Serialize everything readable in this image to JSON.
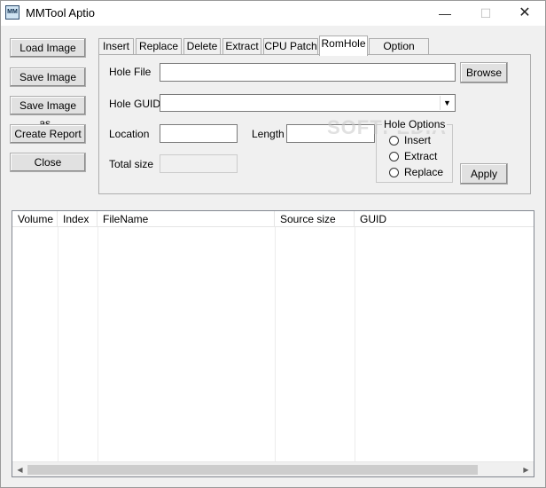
{
  "window": {
    "title": "MMTool Aptio",
    "icon": "MM"
  },
  "controls": {
    "minimize": "—",
    "maximize": "☐",
    "close": "✕"
  },
  "left_buttons": [
    "Load Image",
    "Save Image",
    "Save Image as..",
    "Create Report",
    "Close"
  ],
  "tabs": [
    {
      "label": "Insert"
    },
    {
      "label": "Replace"
    },
    {
      "label": "Delete"
    },
    {
      "label": "Extract"
    },
    {
      "label": "CPU Patch"
    },
    {
      "label": "RomHole",
      "active": true
    },
    {
      "label": "Option ROM"
    }
  ],
  "form": {
    "hole_file_label": "Hole File",
    "hole_file_value": "",
    "browse_button": "Browse",
    "hole_guid_label": "Hole GUID",
    "hole_guid_value": "",
    "location_label": "Location",
    "location_value": "",
    "length_label": "Length",
    "length_value": "",
    "total_size_label": "Total size",
    "total_size_value": "",
    "apply_button": "Apply"
  },
  "hole_options": {
    "title": "Hole Options",
    "options": [
      "Insert",
      "Extract",
      "Replace"
    ]
  },
  "watermark": "SOFTPEDIA",
  "table": {
    "columns": [
      "Volume",
      "Index",
      "FileName",
      "Source size",
      "GUID"
    ],
    "rows": []
  }
}
